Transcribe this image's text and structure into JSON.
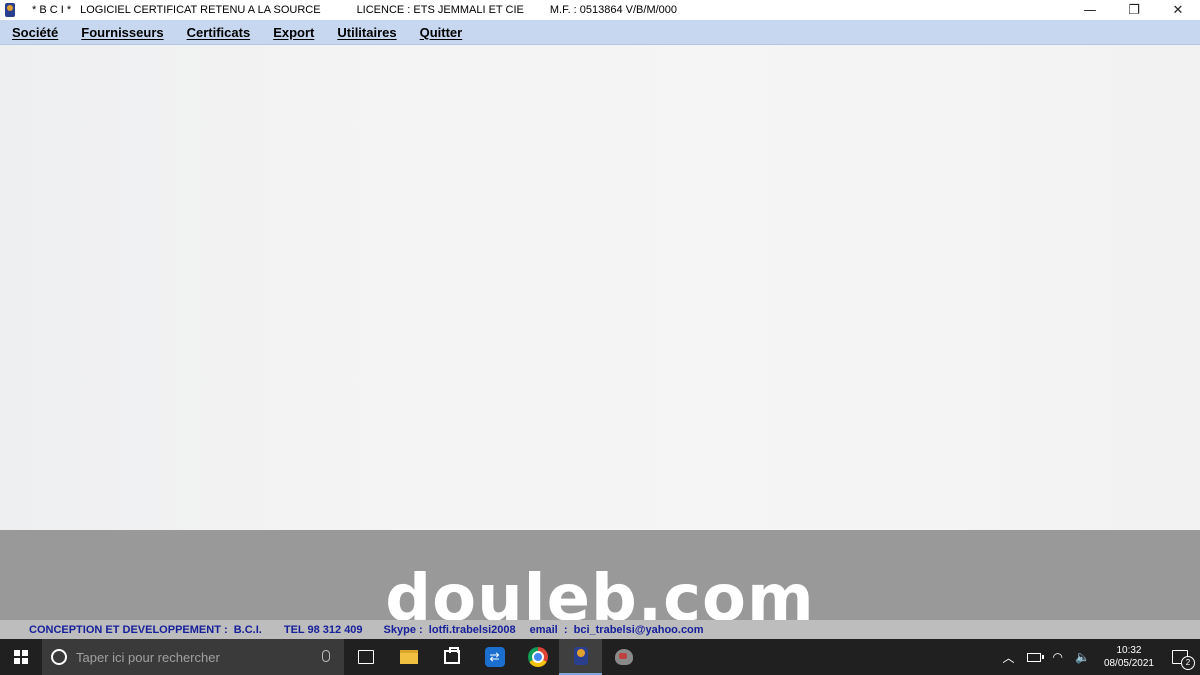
{
  "titlebar": {
    "app_name": "* B C I *",
    "software": "LOGICIEL CERTIFICAT RETENU A LA SOURCE",
    "licence": "LICENCE : ETS JEMMALI ET CIE",
    "mf": "M.F. : 0513864 V/B/M/000",
    "minimize": "—",
    "restore": "❐",
    "close": "✕"
  },
  "menu": {
    "items": [
      {
        "label": "Société"
      },
      {
        "label": "Fournisseurs"
      },
      {
        "label": "Certificats"
      },
      {
        "label": "Export"
      },
      {
        "label": "Utilitaires"
      },
      {
        "label": "Quitter"
      }
    ]
  },
  "watermark": "douleb.com",
  "footer": {
    "conception": "CONCEPTION ET DEVELOPPEMENT :  B.C.I.",
    "tel": "TEL 98 312 409",
    "skype": "Skype :  lotfi.trabelsi2008",
    "email": "email  :  bci_trabelsi@yahoo.com"
  },
  "taskbar": {
    "search_placeholder": "Taper ici pour rechercher",
    "teamviewer_glyph": "⇄",
    "chevron_glyph": "︿",
    "wifi_glyph": "◠",
    "volume_glyph": "🔈",
    "time": "10:32",
    "date": "08/05/2021",
    "notifications": "2"
  }
}
